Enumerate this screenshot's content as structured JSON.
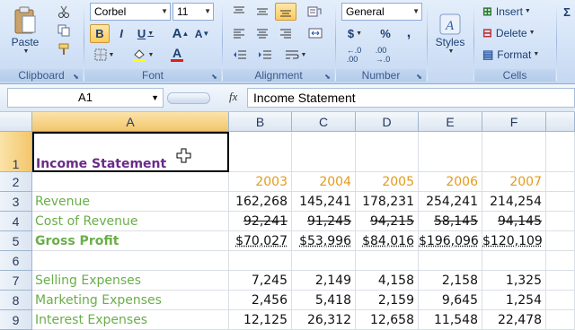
{
  "ribbon": {
    "clipboard": {
      "label": "Clipboard",
      "paste_label": "Paste"
    },
    "font": {
      "label": "Font",
      "family": "Corbel",
      "size": "11",
      "bold": "B",
      "italic": "I",
      "underline": "U",
      "grow": "A",
      "shrink": "A"
    },
    "alignment": {
      "label": "Alignment"
    },
    "number": {
      "label": "Number",
      "format": "General",
      "currency": "$",
      "percent": "%",
      "comma": ","
    },
    "styles": {
      "label": "Styles"
    },
    "cells": {
      "label": "Cells",
      "insert": "Insert",
      "delete": "Delete",
      "format": "Format"
    }
  },
  "formula_bar": {
    "name_box": "A1",
    "fx": "fx",
    "content": "Income Statement"
  },
  "columns": [
    "A",
    "B",
    "C",
    "D",
    "E",
    "F"
  ],
  "rows": [
    {
      "n": "1",
      "a": "Income Statement",
      "v": [
        "",
        "",
        "",
        "",
        ""
      ]
    },
    {
      "n": "2",
      "a": "",
      "v": [
        "2003",
        "2004",
        "2005",
        "2006",
        "2007"
      ]
    },
    {
      "n": "3",
      "a": "Revenue",
      "v": [
        "162,268",
        "145,241",
        "178,231",
        "254,241",
        "214,254"
      ]
    },
    {
      "n": "4",
      "a": "Cost of Revenue",
      "v": [
        "92,241",
        "91,245",
        "94,215",
        "58,145",
        "94,145"
      ]
    },
    {
      "n": "5",
      "a": "Gross Profit",
      "v": [
        "$70,027",
        "$53,996",
        "$84,016",
        "$196,096",
        "$120,109"
      ]
    },
    {
      "n": "6",
      "a": "",
      "v": [
        "",
        "",
        "",
        "",
        ""
      ]
    },
    {
      "n": "7",
      "a": "Selling Expenses",
      "v": [
        "7,245",
        "2,149",
        "4,158",
        "2,158",
        "1,325"
      ]
    },
    {
      "n": "8",
      "a": "Marketing Expenses",
      "v": [
        "2,456",
        "5,418",
        "2,159",
        "9,645",
        "1,254"
      ]
    },
    {
      "n": "9",
      "a": "Interest Expenses",
      "v": [
        "12,125",
        "26,312",
        "12,658",
        "11,548",
        "22,478"
      ]
    }
  ],
  "colors": {
    "title": "#6b2a8a",
    "labels": "#6aae4a",
    "years": "#e39b1c",
    "selection": "#f3c66d"
  },
  "icons": [
    "cut-icon",
    "copy-icon",
    "format-painter-icon",
    "paste-icon",
    "fill-color-icon",
    "font-color-icon",
    "borders-icon",
    "styles-icon",
    "insert-icon",
    "delete-icon",
    "format-icon",
    "fx-icon",
    "cell-select-cursor-icon"
  ]
}
